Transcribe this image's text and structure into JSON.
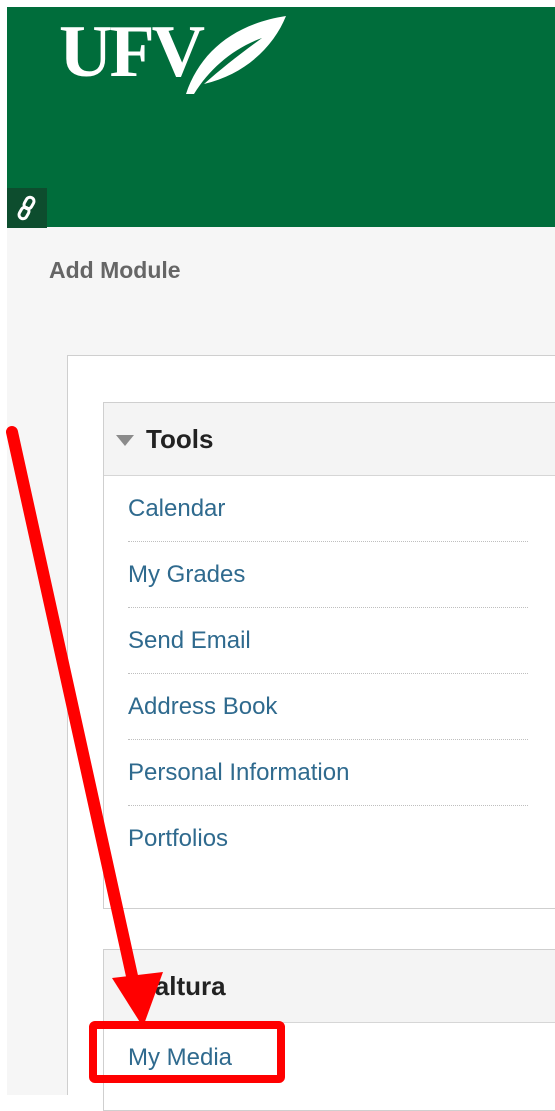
{
  "banner": {
    "logo_text": "UFV",
    "logo_icon": "leaf-icon",
    "link_icon": "link-icon",
    "color": "#006d3b"
  },
  "page": {
    "add_module_label": "Add Module"
  },
  "modules": {
    "tools": {
      "title": "Tools",
      "items": [
        {
          "label": "Calendar"
        },
        {
          "label": "My Grades"
        },
        {
          "label": "Send Email"
        },
        {
          "label": "Address Book"
        },
        {
          "label": "Personal Information"
        },
        {
          "label": "Portfolios"
        }
      ]
    },
    "kaltura": {
      "title": "Kaltura",
      "items": [
        {
          "label": "My Media"
        }
      ]
    }
  },
  "annotation": {
    "color": "#ff0000",
    "target": "My Media"
  },
  "colors": {
    "link": "#2f6a8e",
    "heading": "#222222",
    "muted": "#666666"
  }
}
